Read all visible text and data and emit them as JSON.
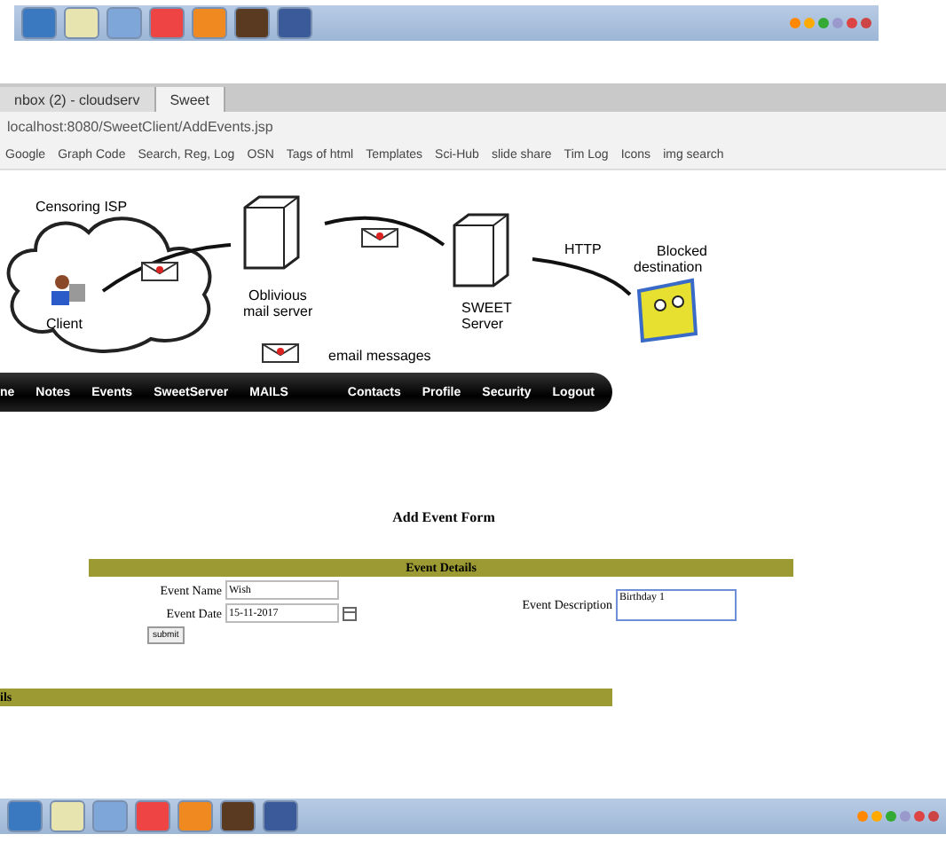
{
  "browser": {
    "tabs": [
      {
        "label": "nbox (2) - cloudserv",
        "selected": false
      },
      {
        "label": "Sweet",
        "selected": true
      }
    ],
    "address": "localhost:8080/SweetClient/AddEvents.jsp",
    "bookmarks": [
      "Google",
      "Graph Code",
      "Search, Reg, Log",
      "OSN",
      "Tags of html",
      "Templates",
      "Sci-Hub",
      "slide share",
      "Tim Log",
      "Icons",
      "img search"
    ]
  },
  "diagram": {
    "labels": [
      "Censoring ISP",
      "Client",
      "Oblivious mail server",
      "SWEET Server",
      "HTTP",
      "Blocked destination",
      "email messages"
    ]
  },
  "nav": {
    "left": [
      "ne",
      "Notes",
      "Events",
      "SweetServer",
      "MAILS"
    ],
    "right": [
      "Contacts",
      "Profile",
      "Security",
      "Logout"
    ]
  },
  "form": {
    "title": "Add Event Form",
    "section": "Event Details",
    "fields": [
      {
        "label": "Event Name",
        "value": "Wish",
        "kind": "text"
      },
      {
        "label": "Event Date",
        "value": "15-11-2017",
        "kind": "date"
      }
    ],
    "description": {
      "label": "Event Description",
      "value": "Birthday 1",
      "focused": true
    },
    "submit": "submit",
    "footer": "ils"
  }
}
